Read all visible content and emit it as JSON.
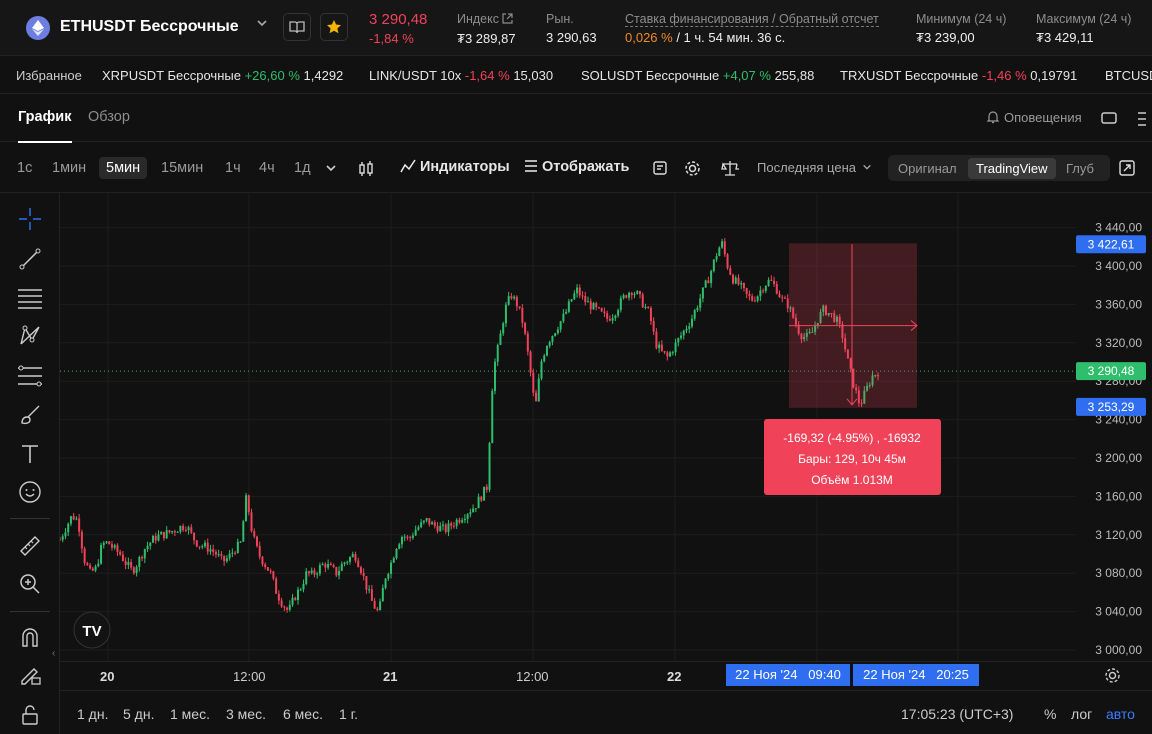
{
  "header": {
    "symbol": "ETHUSDT Бессрочные",
    "last_price": "3 290,48",
    "change_pct": "-1,84 %",
    "index_label": "Индекс",
    "index_value": "₮3 289,87",
    "market_label": "Рын.",
    "market_value": "3 290,63",
    "funding_label": "Ставка финансирования / Обратный отсчет",
    "funding_rate": "0,026 %",
    "funding_countdown": "/ 1 ч. 54 мин. 36 с.",
    "low_label": "Минимум (24 ч)",
    "low_value": "₮3 239,00",
    "high_label": "Максимум (24 ч)",
    "high_value": "₮3 429,11"
  },
  "ticker": {
    "favorites_label": "Избранное",
    "items": [
      {
        "name": "XRPUSDT Бессрочные",
        "change": "+26,60 %",
        "price": "1,4292"
      },
      {
        "name": "LINK/USDT 10x",
        "change": "-1,64 %",
        "price": "15,030"
      },
      {
        "name": "SOLUSDT Бессрочные",
        "change": "+4,07 %",
        "price": "255,88"
      },
      {
        "name": "TRXUSDT Бессрочные",
        "change": "-1,46 %",
        "price": "0,19791"
      },
      {
        "name": "BTCUSD",
        "change": "",
        "price": ""
      }
    ]
  },
  "tabs": {
    "chart": "График",
    "overview": "Обзор",
    "alerts": "Оповещения"
  },
  "toolbar": {
    "timeframes": [
      "1с",
      "1мин",
      "5мин",
      "15мин",
      "1ч",
      "4ч",
      "1д"
    ],
    "active_timeframe": "5мин",
    "indicators": "Индикаторы",
    "display": "Отображать",
    "price_type": "Последняя цена",
    "views": [
      "Оригинал",
      "TradingView",
      "Глуб"
    ]
  },
  "colors": {
    "up": "#2fbe6b",
    "down": "#f0435a",
    "accent": "#2f6ef0",
    "measure": "#f0435a"
  },
  "chart_data": {
    "type": "candlestick",
    "y_ticks": [
      "3 440,00",
      "3 400,00",
      "3 360,00",
      "3 320,00",
      "3 280,00",
      "3 240,00",
      "3 200,00",
      "3 160,00",
      "3 120,00",
      "3 080,00",
      "3 040,00",
      "3 000,00"
    ],
    "ylim": [
      3000,
      3440
    ],
    "x_ticks": [
      "20",
      "12:00",
      "21",
      "12:00",
      "22"
    ],
    "close_series": [
      3115,
      3128,
      3140,
      3135,
      3095,
      3080,
      3085,
      3110,
      3112,
      3105,
      3100,
      3090,
      3082,
      3092,
      3105,
      3112,
      3118,
      3120,
      3122,
      3125,
      3128,
      3130,
      3118,
      3110,
      3108,
      3105,
      3100,
      3092,
      3096,
      3105,
      3110,
      3160,
      3120,
      3100,
      3090,
      3080,
      3060,
      3048,
      3040,
      3055,
      3065,
      3080,
      3078,
      3085,
      3090,
      3085,
      3080,
      3090,
      3095,
      3100,
      3085,
      3065,
      3048,
      3038,
      3075,
      3090,
      3110,
      3120,
      3115,
      3125,
      3130,
      3135,
      3130,
      3128,
      3125,
      3130,
      3135,
      3140,
      3145,
      3150,
      3160,
      3170,
      3290,
      3320,
      3355,
      3370,
      3360,
      3340,
      3300,
      3250,
      3300,
      3320,
      3330,
      3340,
      3350,
      3365,
      3375,
      3365,
      3360,
      3355,
      3350,
      3345,
      3350,
      3360,
      3370,
      3375,
      3370,
      3360,
      3350,
      3320,
      3310,
      3305,
      3315,
      3325,
      3335,
      3345,
      3360,
      3375,
      3390,
      3410,
      3425,
      3400,
      3385,
      3380,
      3370,
      3365,
      3370,
      3380,
      3385,
      3378,
      3365,
      3360,
      3345,
      3330,
      3325,
      3330,
      3345,
      3355,
      3350,
      3345,
      3330,
      3300,
      3275,
      3255,
      3270,
      3285,
      3290
    ],
    "last_price": 3290.48,
    "last_price_label": "3 290,48",
    "measure": {
      "from": 3422.61,
      "to": 3253.29,
      "from_label": "3 422,61",
      "to_label": "3 253,29",
      "line1": "-169,32 (-4.95%) , -16932",
      "line2": "Бары: 129, 10ч 45м",
      "line3": "Объём 1.013M"
    },
    "x_start_label": "22 Ноя '24   09:40",
    "x_end_label": "22 Ноя '24   20:25"
  },
  "bottom": {
    "ranges": [
      "1 дн.",
      "5 дн.",
      "1 мес.",
      "3 мес.",
      "6 мес.",
      "1 г."
    ],
    "clock": "17:05:23 (UTC+3)",
    "percent": "%",
    "log": "лог",
    "auto": "авто"
  }
}
